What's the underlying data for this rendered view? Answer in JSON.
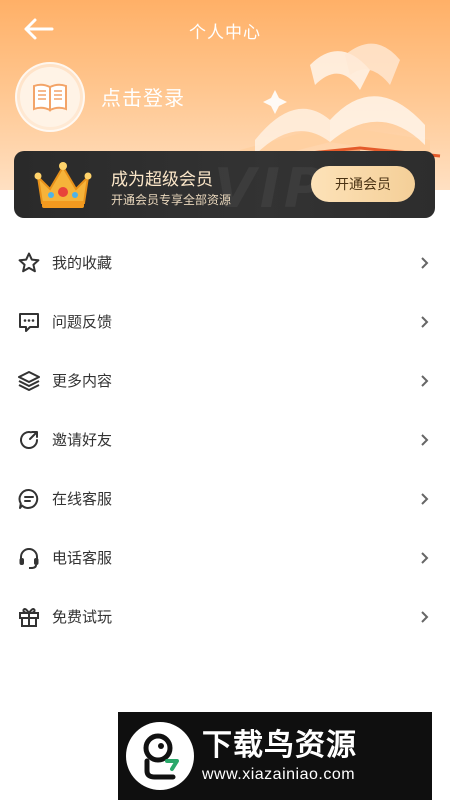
{
  "header": {
    "title": "个人中心",
    "login_text": "点击登录",
    "back_icon": "back-arrow-icon",
    "avatar_icon": "book-icon"
  },
  "vip": {
    "title": "成为超级会员",
    "subtitle": "开通会员专享全部资源",
    "button_label": "开通会员",
    "watermark": "VIP",
    "crown_icon": "crown-icon"
  },
  "menu": {
    "items": [
      {
        "label": "我的收藏",
        "icon": "star-icon"
      },
      {
        "label": "问题反馈",
        "icon": "feedback-icon"
      },
      {
        "label": "更多内容",
        "icon": "layers-icon"
      },
      {
        "label": "邀请好友",
        "icon": "share-icon"
      },
      {
        "label": "在线客服",
        "icon": "chat-icon"
      },
      {
        "label": "电话客服",
        "icon": "headset-icon"
      },
      {
        "label": "免费试玩",
        "icon": "gift-icon"
      }
    ]
  },
  "watermark": {
    "title": "下载鸟资源",
    "url": "www.xiazainiao.com"
  },
  "colors": {
    "header_orange": "#ffb067",
    "vip_dark": "#2a2a2a",
    "vip_gold": "#fbe6c8"
  }
}
